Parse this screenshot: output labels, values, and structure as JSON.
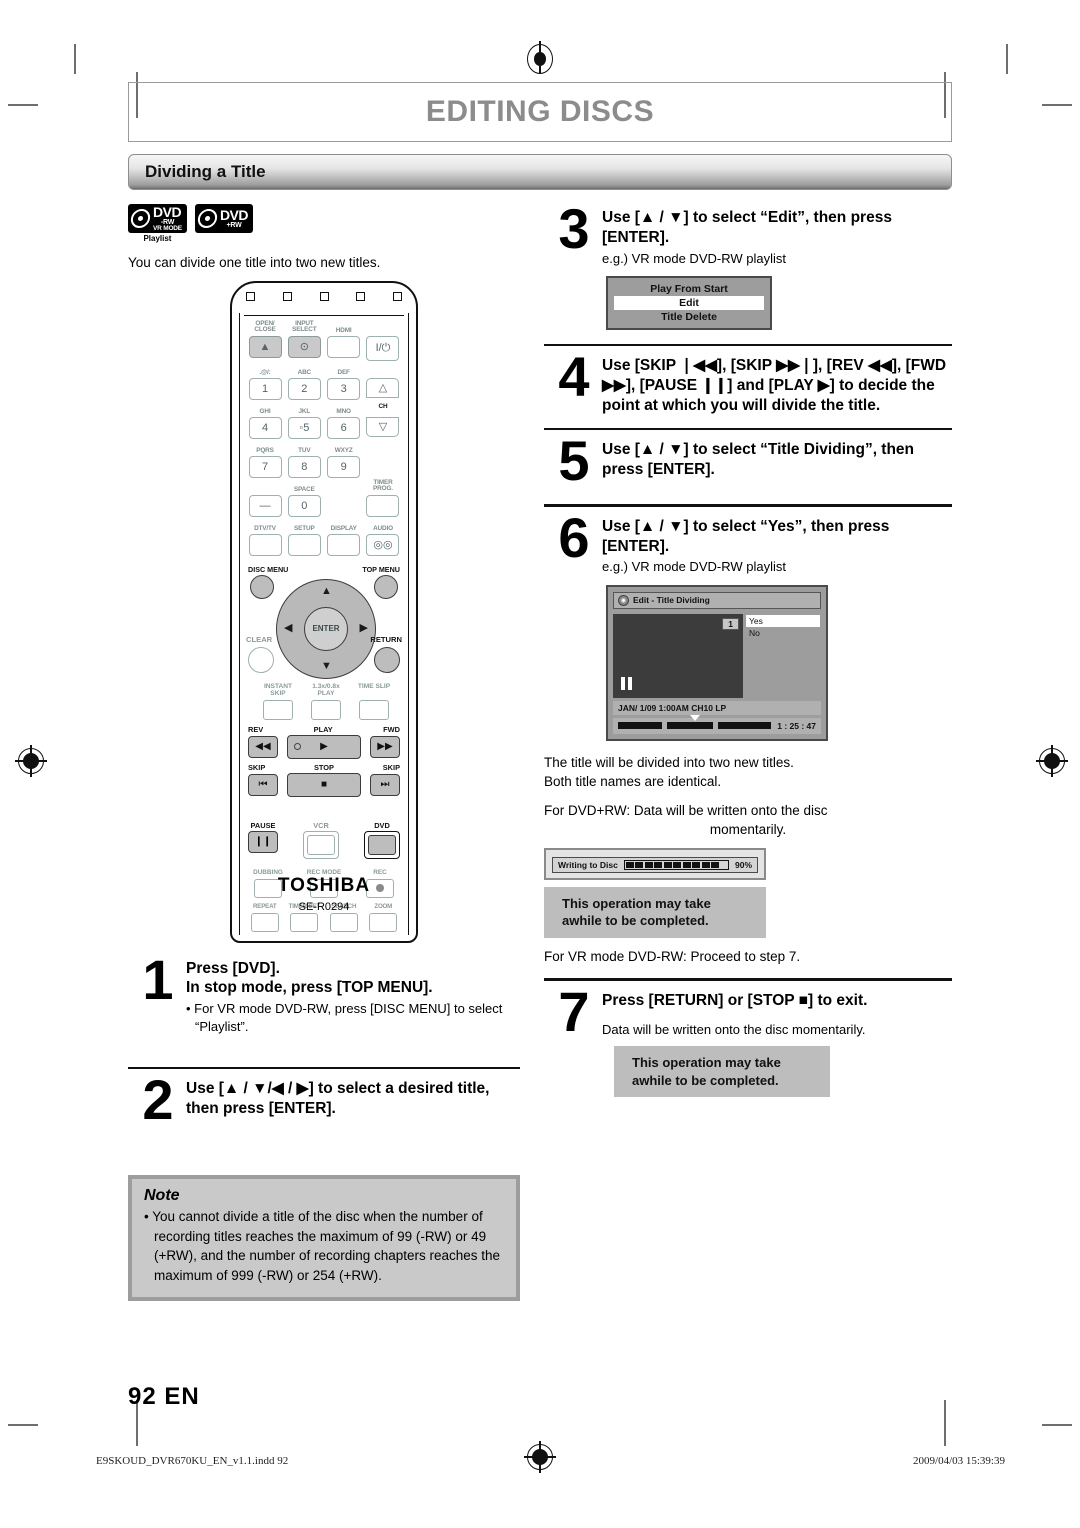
{
  "chapter": {
    "title": "EDITING DISCS"
  },
  "section": {
    "title": "Dividing a Title"
  },
  "disc_logos": [
    {
      "main": "DVD",
      "sub1": "-RW",
      "sub2": "VR MODE",
      "caption": "Playlist"
    },
    {
      "main": "DVD",
      "sub1": "+RW",
      "sub2": "",
      "caption": ""
    }
  ],
  "intro": "You can divide one title into two new titles.",
  "remote": {
    "brand": "TOSHIBA",
    "model": "SE-R0294",
    "keys": {
      "open_close": "OPEN/\nCLOSE",
      "input_select": "INPUT\nSELECT",
      "hdmi": "HDMI",
      "power": "I/⏻",
      "k1_lbl": ".@/:",
      "k1": "1",
      "k2_lbl": "ABC",
      "k2": "2",
      "k3_lbl": "DEF",
      "k3": "3",
      "k4_lbl": "GHI",
      "k4": "4",
      "k5_lbl": "JKL",
      "k5": "5",
      "k6_lbl": "MNO",
      "k6": "6",
      "k7_lbl": "PQRS",
      "k7": "7",
      "k8_lbl": "TUV",
      "k8": "8",
      "k9_lbl": "WXYZ",
      "k9": "9",
      "dash": "—",
      "space_lbl": "SPACE",
      "k0": "0",
      "ch": "CH",
      "timer_prog": "TIMER\nPROG.",
      "dtv_tv": "DTV/TV",
      "setup": "SETUP",
      "display": "DISPLAY",
      "audio": "AUDIO",
      "disc_menu": "DISC MENU",
      "top_menu": "TOP MENU",
      "enter": "ENTER",
      "clear": "CLEAR",
      "return": "RETURN",
      "instant_skip": "INSTANT\nSKIP",
      "play_speed": "1.3x/0.8x\nPLAY",
      "time_slip": "TIME SLIP",
      "rev": "REV",
      "play": "PLAY",
      "fwd": "FWD",
      "skip_left": "SKIP",
      "stop": "STOP",
      "skip_right": "SKIP",
      "pause": "PAUSE",
      "vcr": "VCR",
      "dvd": "DVD",
      "dubbing": "DUBBING",
      "rec_mode": "REC MODE",
      "rec": "REC",
      "repeat": "REPEAT",
      "timer_set": "TIMER SET",
      "search": "SEARCH",
      "zoom": "ZOOM"
    }
  },
  "steps": {
    "s1": {
      "num": "1",
      "head_line1": "Press [DVD].",
      "head_line2": "In stop mode, press [TOP MENU].",
      "bullet": "• For VR mode DVD-RW, press [DISC MENU] to select “Playlist”."
    },
    "s2": {
      "num": "2",
      "head": "Use [▲ / ▼/◀ / ▶] to select a desired title, then press [ENTER]."
    },
    "s3": {
      "num": "3",
      "head": "Use [▲ / ▼] to select “Edit”, then press [ENTER].",
      "eg": "e.g.) VR mode DVD-RW playlist",
      "menu": {
        "items": [
          "Play From Start",
          "Edit",
          "Title Delete"
        ],
        "selected_index": 1
      }
    },
    "s4": {
      "num": "4",
      "head": "Use [SKIP ❘◀◀], [SKIP ▶▶❘], [REV ◀◀], [FWD ▶▶], [PAUSE ❙❙] and [PLAY ▶] to decide the point at which you will divide the title."
    },
    "s5": {
      "num": "5",
      "head": "Use [▲ / ▼] to select “Title Dividing”, then press [ENTER]."
    },
    "s6": {
      "num": "6",
      "head": "Use [▲ / ▼] to select “Yes”, then press [ENTER].",
      "eg": "e.g.) VR mode DVD-RW playlist",
      "osd": {
        "window_title": "Edit - Title Dividing",
        "chapter_number": "1",
        "options": [
          "Yes",
          "No"
        ],
        "selected_index": 0,
        "info_line": "JAN/ 1/09 1:00AM CH10   LP",
        "time_code": "1 : 25 : 47"
      },
      "after_1": "The title will be divided into two new titles.",
      "after_2": "Both title names are identical.",
      "after_3": "For DVD+RW: Data will be written onto the disc",
      "after_3b": "momentarily.",
      "writing": {
        "label": "Writing to Disc",
        "percent": "90%"
      },
      "notice_line1": "This operation may take",
      "notice_line2": "awhile to be completed.",
      "after_4": "For VR mode DVD-RW: Proceed to step 7."
    },
    "s7": {
      "num": "7",
      "head": "Press [RETURN] or [STOP ■] to exit.",
      "sub": "Data will be written onto the disc momentarily.",
      "notice_line1": "This operation may take",
      "notice_line2": "awhile to be completed."
    }
  },
  "note": {
    "title": "Note",
    "body": "• You cannot divide a title of the disc when the number of recording titles reaches the maximum of 99 (-RW) or 49 (+RW), and the number of recording chapters reaches the maximum of 999 (-RW) or 254 (+RW)."
  },
  "page_number": "92   EN",
  "footer": {
    "left": "E9SKOUD_DVR670KU_EN_v1.1.indd   92",
    "right": "2009/04/03   15:39:39"
  }
}
